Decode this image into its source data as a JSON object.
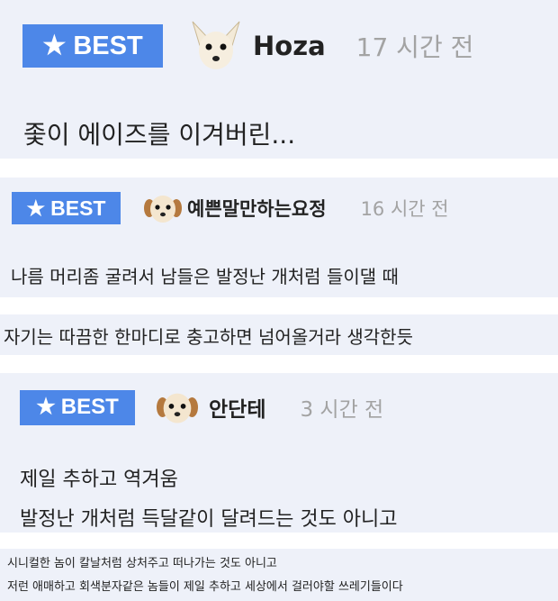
{
  "posts": [
    {
      "badge": "BEST",
      "author": "Hoza",
      "time": "17 시간 전",
      "avatar": "chihuahua-avatar-icon",
      "lines": [
        "좇이 에이즈를 이겨버린..."
      ]
    },
    {
      "badge": "BEST",
      "author": "예쁜말만하는요정",
      "time": "16 시간 전",
      "avatar": "puppy-avatar-icon",
      "lines": [
        "나름 머리좀 굴려서 남들은 발정난 개처럼 들이댈 때"
      ]
    },
    {
      "lines": [
        "자기는 따끔한 한마디로 충고하면 넘어올거라 생각한듯"
      ]
    },
    {
      "badge": "BEST",
      "author": "안단테",
      "time": "3 시간 전",
      "avatar": "puppy-avatar-icon",
      "lines": [
        "제일 추하고 역겨움",
        "발정난 개처럼 득달같이 달려드는 것도 아니고"
      ]
    },
    {
      "lines": [
        "시니컬한 놈이 칼날처럼 상처주고 떠나가는 것도 아니고",
        "저런 애매하고 회색분자같은 놈들이 제일 추하고 세상에서 걸러야할 쓰레기들이다"
      ]
    }
  ],
  "colors": {
    "badge": "#4d87e8",
    "panel": "#eef1f9",
    "time": "#a3a3a3"
  }
}
